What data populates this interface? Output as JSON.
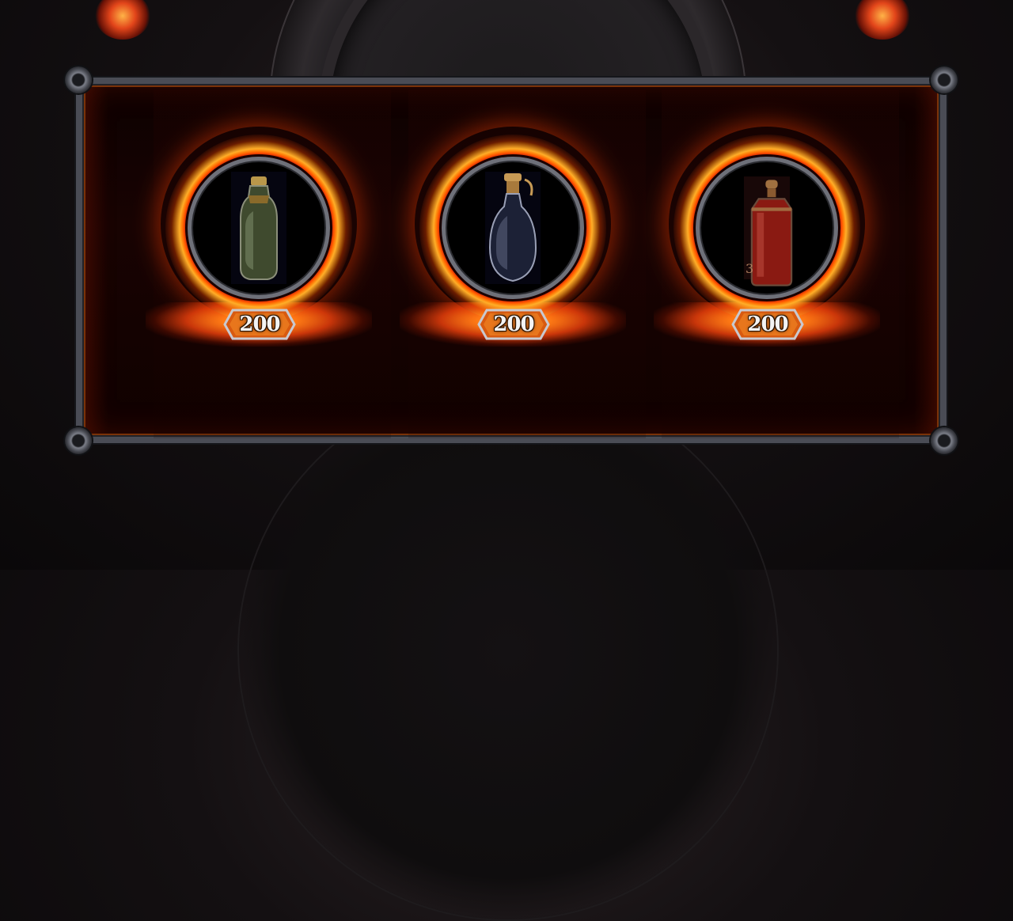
{
  "shop": {
    "items": [
      {
        "icon": "green-potion-icon",
        "price": "200",
        "count": ""
      },
      {
        "icon": "blue-potion-icon",
        "price": "200",
        "count": ""
      },
      {
        "icon": "red-potion-icon",
        "price": "200",
        "count": "3"
      }
    ]
  },
  "colors": {
    "fire": "#ff5a0e",
    "frame": "#4a4c55",
    "badge": "#e0600e"
  }
}
